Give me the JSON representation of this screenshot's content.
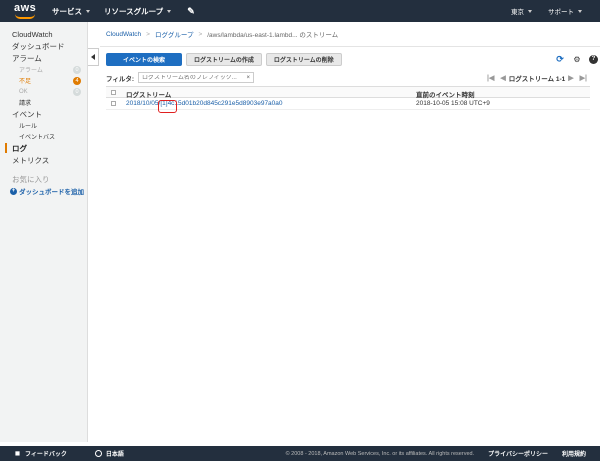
{
  "topnav": {
    "logo": "aws",
    "services": "サービス",
    "resource_groups": "リソースグループ",
    "pin_icon": "pin-icon",
    "region": "東京",
    "support": "サポート"
  },
  "sidebar": {
    "items": [
      {
        "label": "CloudWatch"
      },
      {
        "label": "ダッシュボード"
      },
      {
        "label": "アラーム"
      },
      {
        "label": "アラーム",
        "badge": "0"
      },
      {
        "label": "不足",
        "badge": "4"
      },
      {
        "label": "OK",
        "badge": "0"
      },
      {
        "label": "請求"
      },
      {
        "label": "イベント"
      },
      {
        "label": "ルール"
      },
      {
        "label": "イベントバス"
      },
      {
        "label": "ログ"
      },
      {
        "label": "メトリクス"
      },
      {
        "label": "お気に入り"
      },
      {
        "label": "ダッシュボードを追加"
      }
    ]
  },
  "breadcrumb": {
    "items": [
      "CloudWatch",
      "ロググループ",
      "/aws/lambda/us-east-1.lambd... のストリーム"
    ]
  },
  "toolbar": {
    "search_events": "イベントの検索",
    "create_stream": "ログストリームの作成",
    "delete_stream": "ログストリームの削除"
  },
  "filter": {
    "label": "フィルタ:",
    "placeholder": "ログストリーム名のプレフィック...",
    "clear": "×",
    "pager_label": "ログストリーム 1-1"
  },
  "table": {
    "headers": [
      "ログストリーム",
      "直前のイベント時刻"
    ],
    "rows": [
      {
        "stream": "2018/10/05/[1]4c15d01b20d845c291e5d8903e97a0a0",
        "time": "2018-10-05 15:08 UTC+9"
      }
    ]
  },
  "footer": {
    "feedback": "フィードバック",
    "language": "日本語",
    "copyright": "© 2008 - 2018, Amazon Web Services, Inc. or its affiliates. All rights reserved.",
    "privacy": "プライバシーポリシー",
    "terms": "利用規約"
  },
  "colors": {
    "nav_bg": "#232f3e",
    "primary": "#1e6ec1",
    "accent_orange": "#e07b00",
    "highlight_red": "#e02020"
  }
}
